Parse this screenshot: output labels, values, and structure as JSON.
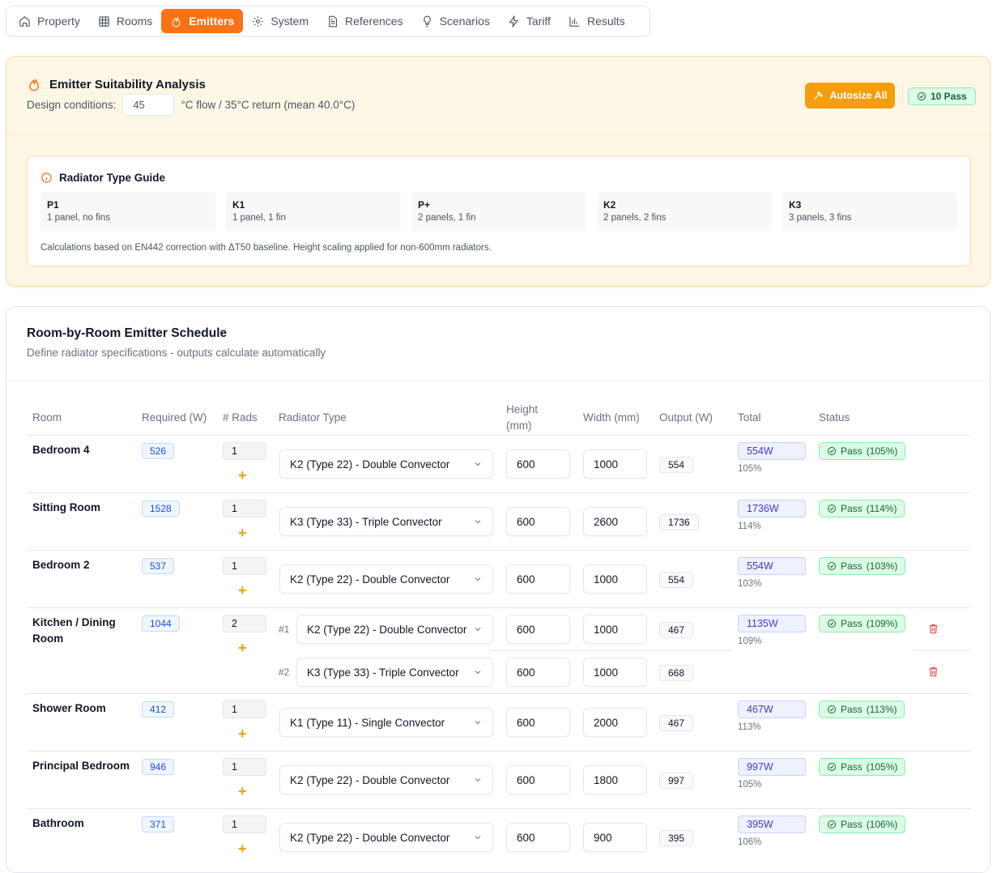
{
  "nav": {
    "tabs": [
      {
        "label": "Property",
        "icon": "home-icon"
      },
      {
        "label": "Rooms",
        "icon": "grid-icon"
      },
      {
        "label": "Emitters",
        "icon": "flame-icon",
        "active": true
      },
      {
        "label": "System",
        "icon": "gear-icon"
      },
      {
        "label": "References",
        "icon": "document-icon"
      },
      {
        "label": "Scenarios",
        "icon": "lightbulb-icon"
      },
      {
        "label": "Tariff",
        "icon": "lightning-icon"
      },
      {
        "label": "Results",
        "icon": "bar-chart-icon"
      }
    ]
  },
  "analysis": {
    "title": "Emitter Suitability Analysis",
    "conditions_label": "Design conditions:",
    "flow_temp": "45",
    "conditions_suffix": "°C flow / 35°C return (mean 40.0°C)",
    "autosize_label": "Autosize All",
    "pass_count": "10 Pass"
  },
  "guide": {
    "title": "Radiator Type Guide",
    "types": [
      {
        "code": "P1",
        "desc": "1 panel, no fins"
      },
      {
        "code": "K1",
        "desc": "1 panel, 1 fin"
      },
      {
        "code": "P+",
        "desc": "2 panels, 1 fin"
      },
      {
        "code": "K2",
        "desc": "2 panels, 2 fins"
      },
      {
        "code": "K3",
        "desc": "3 panels, 3 fins"
      }
    ],
    "note": "Calculations based on EN442 correction with ΔT50 baseline. Height scaling applied for non-600mm radiators."
  },
  "schedule": {
    "title": "Room-by-Room Emitter Schedule",
    "subtitle": "Define radiator specifications - outputs calculate automatically",
    "headers": {
      "room": "Room",
      "required": "Required (W)",
      "rads": "# Rads",
      "type": "Radiator Type",
      "height_1": "Height",
      "height_2": "(mm)",
      "width": "Width (mm)",
      "output": "Output (W)",
      "total": "Total",
      "status": "Status"
    },
    "rows": [
      {
        "room": "Bedroom 4",
        "required": "526",
        "rads": "1",
        "radiators": [
          {
            "type": "K2 (Type 22) - Double Convector",
            "height": "600",
            "width": "1000",
            "output": "554"
          }
        ],
        "total": "554W",
        "pct": "105%",
        "status": "Pass",
        "status_pct": "(105%)"
      },
      {
        "room": "Sitting Room",
        "required": "1528",
        "rads": "1",
        "radiators": [
          {
            "type": "K3 (Type 33) - Triple Convector",
            "height": "600",
            "width": "2600",
            "output": "1736"
          }
        ],
        "total": "1736W",
        "pct": "114%",
        "status": "Pass",
        "status_pct": "(114%)"
      },
      {
        "room": "Bedroom 2",
        "required": "537",
        "rads": "1",
        "radiators": [
          {
            "type": "K2 (Type 22) - Double Convector",
            "height": "600",
            "width": "1000",
            "output": "554"
          }
        ],
        "total": "554W",
        "pct": "103%",
        "status": "Pass",
        "status_pct": "(103%)"
      },
      {
        "room": "Kitchen / Dining Room",
        "required": "1044",
        "rads": "2",
        "radiators": [
          {
            "index": "#1",
            "type": "K2 (Type 22) - Double Convector",
            "height": "600",
            "width": "1000",
            "output": "467"
          },
          {
            "index": "#2",
            "type": "K3 (Type 33) - Triple Convector",
            "height": "600",
            "width": "1000",
            "output": "668"
          }
        ],
        "total": "1135W",
        "pct": "109%",
        "status": "Pass",
        "status_pct": "(109%)"
      },
      {
        "room": "Shower Room",
        "required": "412",
        "rads": "1",
        "radiators": [
          {
            "type": "K1 (Type 11) - Single Convector",
            "height": "600",
            "width": "2000",
            "output": "467"
          }
        ],
        "total": "467W",
        "pct": "113%",
        "status": "Pass",
        "status_pct": "(113%)"
      },
      {
        "room": "Principal Bedroom",
        "required": "946",
        "rads": "1",
        "radiators": [
          {
            "type": "K2 (Type 22) - Double Convector",
            "height": "600",
            "width": "1800",
            "output": "997"
          }
        ],
        "total": "997W",
        "pct": "105%",
        "status": "Pass",
        "status_pct": "(105%)"
      },
      {
        "room": "Bathroom",
        "required": "371",
        "rads": "1",
        "radiators": [
          {
            "type": "K2 (Type 22) - Double Convector",
            "height": "600",
            "width": "900",
            "output": "395"
          }
        ],
        "total": "395W",
        "pct": "106%",
        "status": "Pass",
        "status_pct": "(106%)"
      }
    ]
  }
}
